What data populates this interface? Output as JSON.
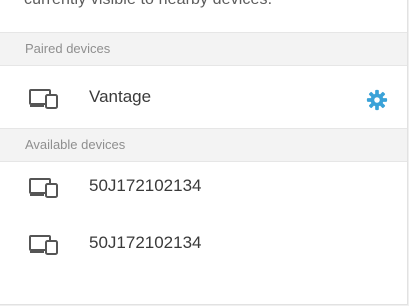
{
  "intro_text": "currently visible to nearby devices.",
  "paired": {
    "header": "Paired devices",
    "devices": [
      {
        "name": "Vantage",
        "icon": "devices-icon",
        "has_settings": true
      }
    ]
  },
  "available": {
    "header": "Available devices",
    "devices": [
      {
        "name": "50J172102134",
        "icon": "devices-icon"
      },
      {
        "name": "50J172102134",
        "icon": "devices-icon"
      }
    ]
  },
  "colors": {
    "accent": "#3aa2d8",
    "section_bg": "#f3f3f3",
    "text": "#3a3a3a",
    "muted": "#8f8f8f"
  }
}
